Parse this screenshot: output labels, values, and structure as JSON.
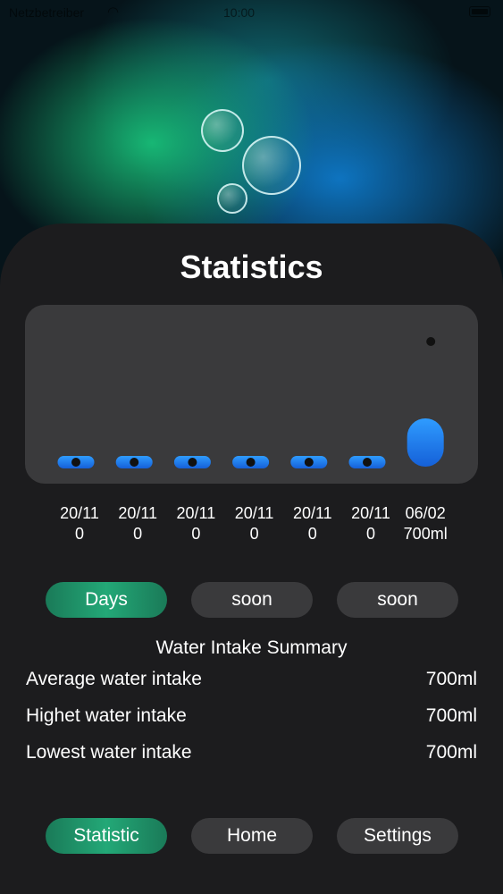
{
  "status_bar": {
    "carrier": "Netzbetreiber",
    "time": "10:00"
  },
  "header": {
    "title": "Statistics"
  },
  "chart_data": {
    "type": "bar",
    "categories": [
      "20/11",
      "20/11",
      "20/11",
      "20/11",
      "20/11",
      "20/11",
      "06/02"
    ],
    "value_labels": [
      "0",
      "0",
      "0",
      "0",
      "0",
      "0",
      "700ml"
    ],
    "values": [
      0,
      0,
      0,
      0,
      0,
      0,
      700
    ],
    "title": "",
    "xlabel": "",
    "ylabel": "",
    "ylim": [
      0,
      700
    ],
    "grid": false,
    "colors": {
      "bar_top": "#2f9cff",
      "bar_bottom": "#1560d8",
      "card": "#3a3a3c"
    }
  },
  "range_selector": {
    "options": [
      {
        "label": "Days",
        "active": true
      },
      {
        "label": "soon",
        "active": false
      },
      {
        "label": "soon",
        "active": false
      }
    ]
  },
  "summary": {
    "title": "Water Intake Summary",
    "rows": [
      {
        "label": "Average water intake",
        "value": "700ml"
      },
      {
        "label": "Highet water intake",
        "value": "700ml"
      },
      {
        "label": "Lowest water intake",
        "value": "700ml"
      }
    ]
  },
  "bottom_nav": {
    "items": [
      {
        "label": "Statistic",
        "active": true
      },
      {
        "label": "Home",
        "active": false
      },
      {
        "label": "Settings",
        "active": false
      }
    ]
  },
  "colors": {
    "accent_green": "#23a877",
    "panel": "#1c1c1e",
    "button": "#3a3a3c"
  }
}
